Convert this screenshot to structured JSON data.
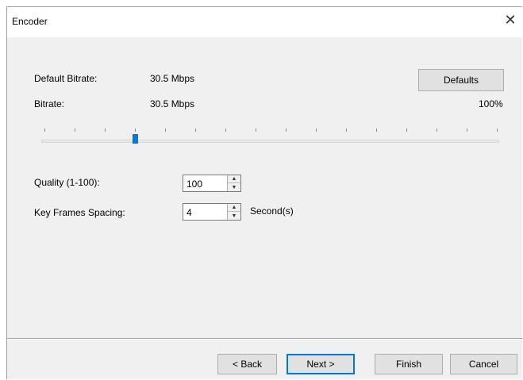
{
  "window": {
    "title": "Encoder",
    "close_glyph": "✕"
  },
  "bitrate": {
    "default_label": "Default Bitrate:",
    "default_value": "30.5 Mbps",
    "label": "Bitrate:",
    "value": "30.5 Mbps",
    "percent": "100%",
    "defaults_button": "Defaults",
    "slider_level_fraction": 0.2
  },
  "quality": {
    "label": "Quality (1-100):",
    "value": "100"
  },
  "keyframes": {
    "label": "Key Frames Spacing:",
    "value": "4",
    "unit": "Second(s)"
  },
  "footer": {
    "back": "< Back",
    "next": "Next >",
    "finish": "Finish",
    "cancel": "Cancel"
  },
  "colors": {
    "accent": "#0078d7",
    "panel": "#f0f0f0",
    "titlebar": "#ffffff"
  },
  "icons": {
    "close": "close-icon",
    "spin_up": "caret-up-icon",
    "spin_down": "caret-down-icon"
  }
}
